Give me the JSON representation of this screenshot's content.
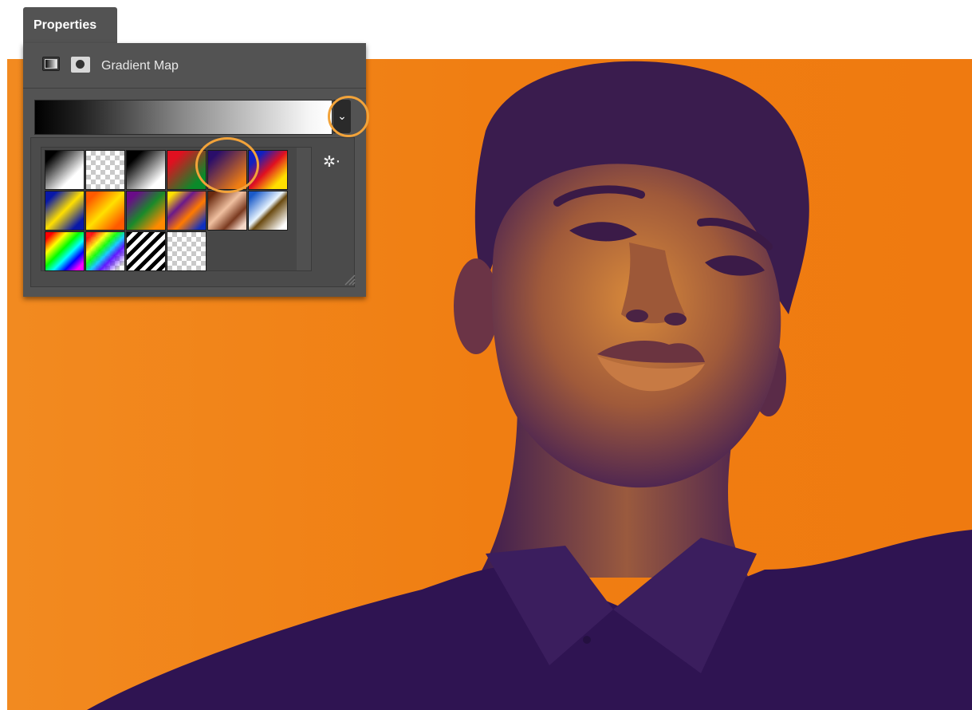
{
  "panel": {
    "tab_label": "Properties",
    "adjustment_title": "Gradient Map",
    "adjustment_icon": "gradient-map-icon",
    "mask_icon": "layer-mask-icon",
    "current_gradient": [
      "#000000",
      "#ffffff"
    ],
    "dropdown_icon": "chevron-down-icon",
    "dropdown_glyph": "⌄",
    "settings_icon": "gear-icon",
    "settings_glyph": "✲‧",
    "highlight_color": "#f2a33a",
    "selected_preset": "violet-orange"
  },
  "presets": [
    {
      "id": "foreground-background",
      "icon": "foreground-to-background-gradient-icon"
    },
    {
      "id": "foreground-transparent",
      "icon": "foreground-to-transparent-gradient-icon"
    },
    {
      "id": "black-white",
      "icon": "black-white-gradient-icon"
    },
    {
      "id": "red-green",
      "icon": "red-green-gradient-icon"
    },
    {
      "id": "violet-orange",
      "icon": "violet-orange-gradient-icon"
    },
    {
      "id": "blue-red-yellow",
      "icon": "blue-red-yellow-gradient-icon"
    },
    {
      "id": "blue-yellow-blue",
      "icon": "blue-yellow-blue-gradient-icon"
    },
    {
      "id": "orange-yellow-orange",
      "icon": "orange-yellow-orange-gradient-icon"
    },
    {
      "id": "violet-green-orange",
      "icon": "violet-green-orange-gradient-icon"
    },
    {
      "id": "yellow-violet-orange-blue",
      "icon": "yellow-violet-orange-blue-gradient-icon"
    },
    {
      "id": "copper",
      "icon": "copper-gradient-icon"
    },
    {
      "id": "chrome",
      "icon": "chrome-gradient-icon"
    },
    {
      "id": "spectrum",
      "icon": "spectrum-gradient-icon"
    },
    {
      "id": "transparent-rainbow",
      "icon": "transparent-rainbow-gradient-icon"
    },
    {
      "id": "transparent-stripes",
      "icon": "transparent-stripes-gradient-icon"
    },
    {
      "id": "neutral-density",
      "icon": "neutral-density-gradient-icon"
    }
  ],
  "canvas": {
    "background_color": "#f07e12",
    "shadow_color": "#2f1452"
  }
}
